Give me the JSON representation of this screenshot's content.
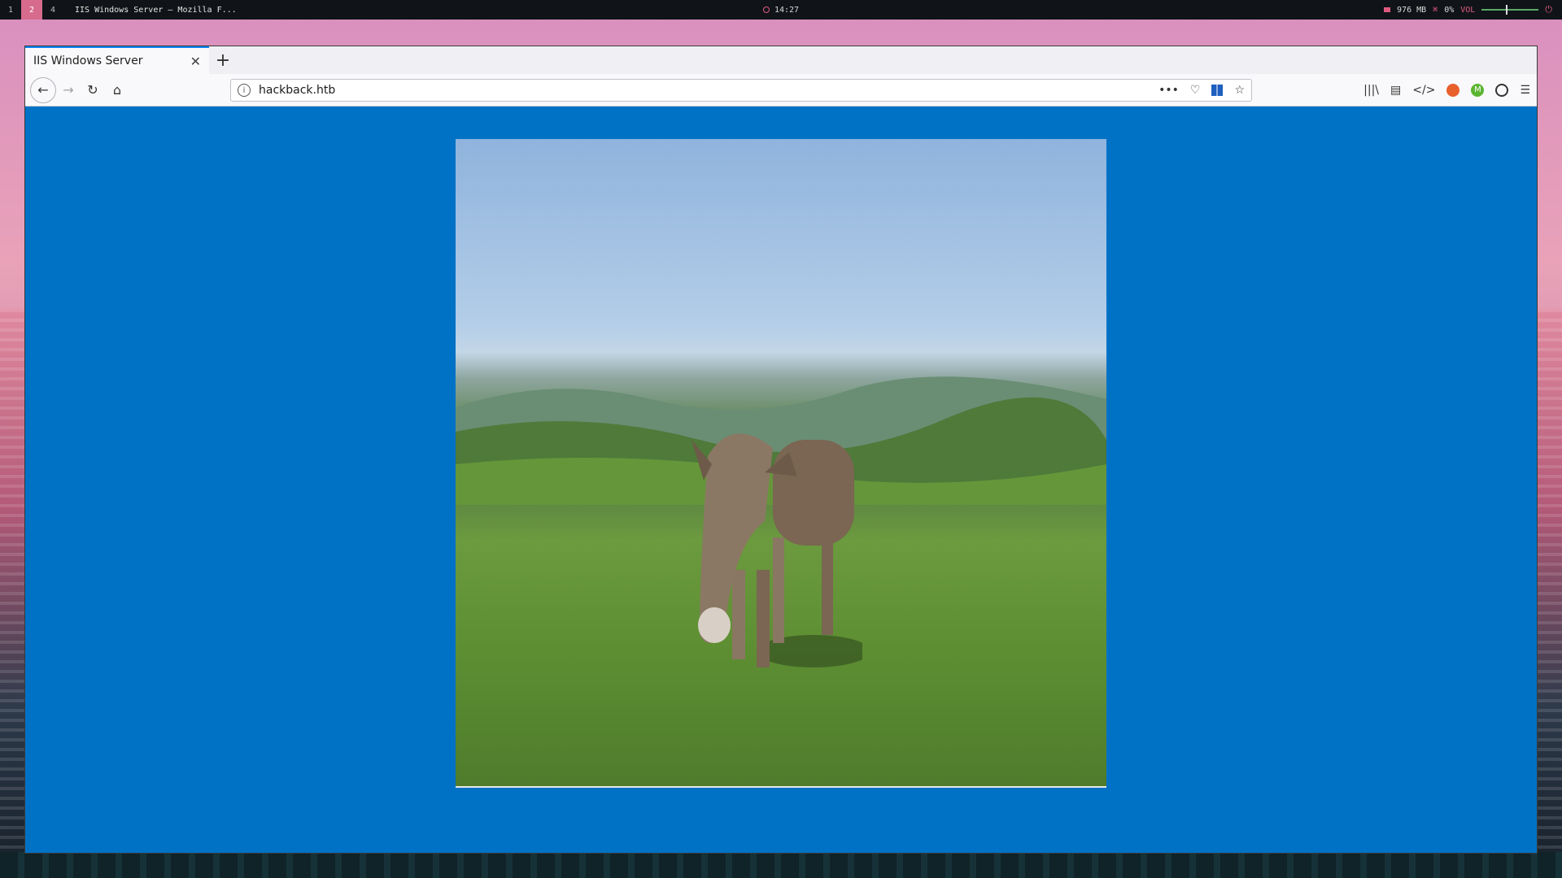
{
  "system_bar": {
    "workspaces": [
      "1",
      "2",
      "4"
    ],
    "window_title": "IIS Windows Server — Mozilla F...",
    "clock": "14:27",
    "memory": "976 MB",
    "cpu": "0%",
    "volume_label": "VOL"
  },
  "browser": {
    "tab_title": "IIS Windows Server",
    "url": "hackback.htb"
  },
  "page": {
    "image_subject": "donkey"
  },
  "colors": {
    "page_background": "#0072c6",
    "accent": "#d66b8e"
  }
}
